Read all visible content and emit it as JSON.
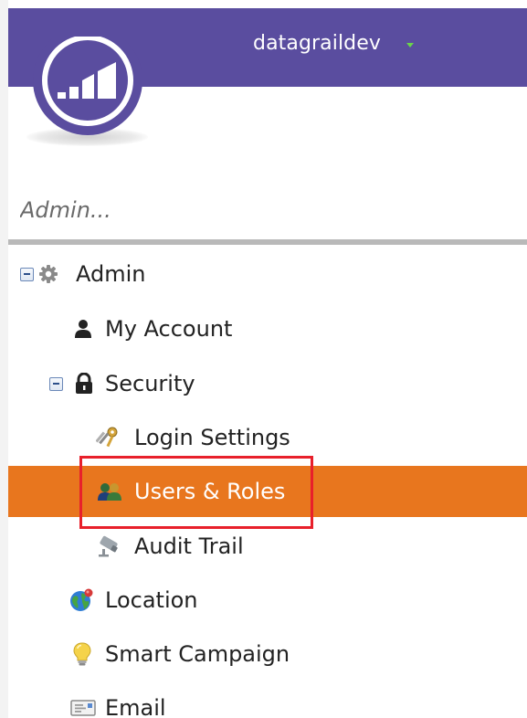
{
  "header": {
    "account_name": "datagraildev",
    "brand_color": "#5a4d9f",
    "caret_color": "#6bd44a"
  },
  "search": {
    "placeholder": "Admin..."
  },
  "tree": {
    "selected_color": "#e8761e",
    "items": [
      {
        "label": "Admin",
        "icon": "gear-icon",
        "expanded": true,
        "level": 0
      },
      {
        "label": "My Account",
        "icon": "user-icon",
        "level": 1
      },
      {
        "label": "Security",
        "icon": "lock-icon",
        "expanded": true,
        "level": 1
      },
      {
        "label": "Login Settings",
        "icon": "keys-icon",
        "level": 2
      },
      {
        "label": "Users & Roles",
        "icon": "users-icon",
        "level": 2,
        "selected": true
      },
      {
        "label": "Audit Trail",
        "icon": "camera-icon",
        "level": 2
      },
      {
        "label": "Location",
        "icon": "globe-icon",
        "level": 1
      },
      {
        "label": "Smart Campaign",
        "icon": "lightbulb-icon",
        "level": 1
      },
      {
        "label": "Email",
        "icon": "email-icon",
        "level": 1
      }
    ]
  },
  "annotation": {
    "highlight_color": "#e8202b"
  }
}
